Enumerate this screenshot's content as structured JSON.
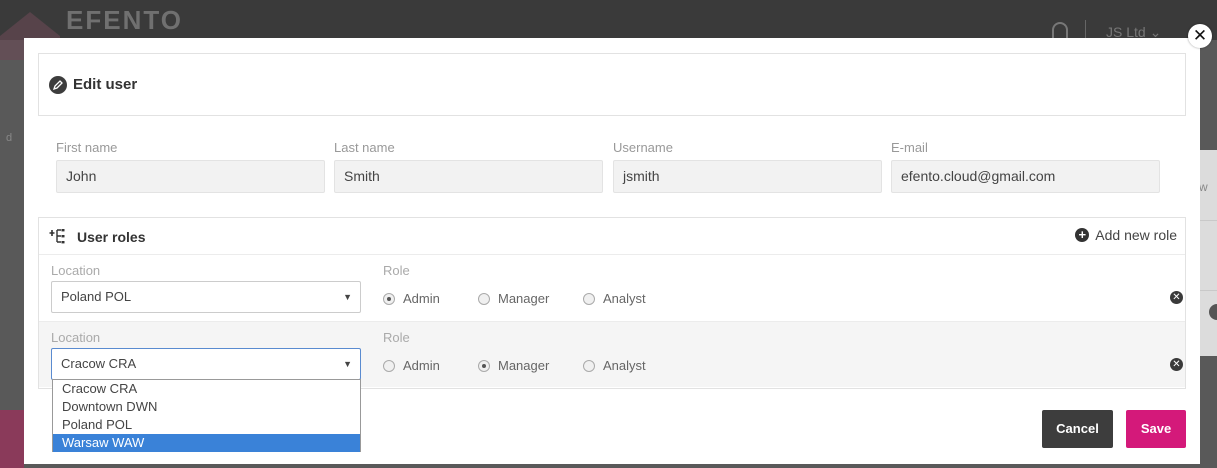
{
  "background": {
    "logo": "EFENTO",
    "account": "JS Ltd ⌄",
    "left_fragment": "d",
    "right_fragment": "w"
  },
  "modal": {
    "title": "Edit user",
    "close_glyph": "✕"
  },
  "fields": {
    "first_name": {
      "label": "First name",
      "value": "John"
    },
    "last_name": {
      "label": "Last name",
      "value": "Smith"
    },
    "username": {
      "label": "Username",
      "value": "jsmith"
    },
    "email": {
      "label": "E-mail",
      "value": "efento.cloud@gmail.com"
    }
  },
  "roles": {
    "title": "User roles",
    "add_label": "Add new role",
    "location_label": "Location",
    "role_label": "Role",
    "options": {
      "admin": "Admin",
      "manager": "Manager",
      "analyst": "Analyst"
    },
    "rows": [
      {
        "location": "Poland POL",
        "selected_role": "Admin"
      },
      {
        "location": "Cracow CRA",
        "selected_role": "Manager"
      }
    ]
  },
  "dropdown": {
    "items": [
      "Cracow CRA",
      "Downtown DWN",
      "Poland POL",
      "Warsaw WAW"
    ],
    "highlighted": "Warsaw WAW"
  },
  "buttons": {
    "cancel": "Cancel",
    "save": "Save"
  },
  "colors": {
    "save": "#d4197a",
    "cancel": "#3d3d3d",
    "highlight": "#3a82d8"
  }
}
